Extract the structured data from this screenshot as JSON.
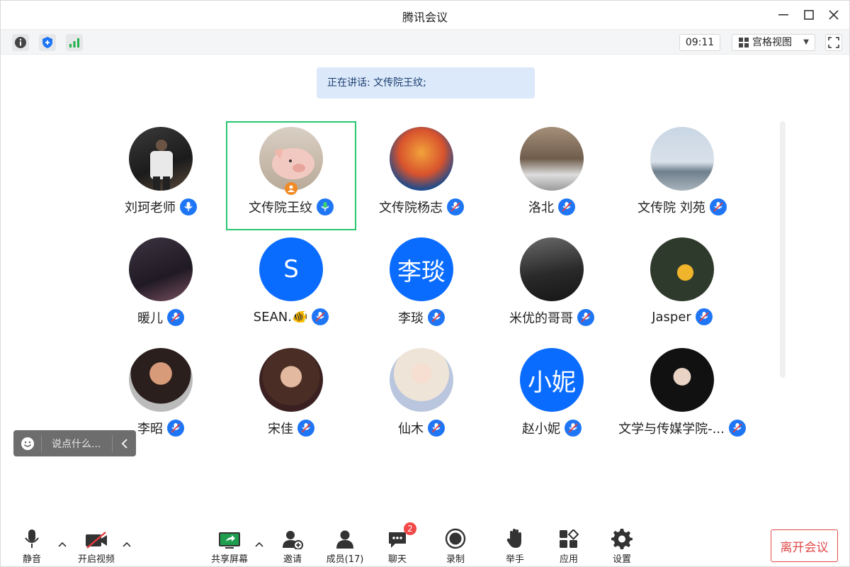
{
  "window": {
    "title": "腾讯会议"
  },
  "toolbar": {
    "time": "09:11",
    "view_label": "宫格视图"
  },
  "speaking": {
    "text": "正在讲话: 文传院王纹;"
  },
  "participants": [
    {
      "name": "刘珂老师",
      "mic": "muted-off"
    },
    {
      "name": "文传院王纹",
      "mic": "active",
      "host": true
    },
    {
      "name": "文传院杨志",
      "mic": "muted"
    },
    {
      "name": "洛北",
      "mic": "muted"
    },
    {
      "name": "文传院 刘苑",
      "mic": "muted"
    },
    {
      "name": "暖儿",
      "mic": "muted"
    },
    {
      "name": "SEAN.🐠",
      "mic": "muted",
      "avatar_letter": "S"
    },
    {
      "name": "李琰",
      "mic": "muted",
      "avatar_letter": "李琰"
    },
    {
      "name": "米优的哥哥",
      "mic": "muted"
    },
    {
      "name": "Jasper",
      "mic": "muted"
    },
    {
      "name": "李昭",
      "mic": "muted"
    },
    {
      "name": "宋佳",
      "mic": "muted"
    },
    {
      "name": "仙木",
      "mic": "muted"
    },
    {
      "name": "赵小妮",
      "mic": "muted",
      "avatar_letter": "小妮"
    },
    {
      "name": "文学与传媒学院-...",
      "mic": "muted"
    }
  ],
  "composer": {
    "placeholder": "说点什么..."
  },
  "bottom": {
    "mute": "静音",
    "video": "开启视频",
    "share": "共享屏幕",
    "invite": "邀请",
    "members": "成员(17)",
    "chat": "聊天",
    "chat_badge": "2",
    "record": "录制",
    "raise_hand": "举手",
    "apps": "应用",
    "settings": "设置",
    "leave": "离开会议"
  },
  "colors": {
    "accent": "#1f76f5",
    "active_border": "#28c76f",
    "leave": "#e14848",
    "banner": "#dbe9fb"
  }
}
